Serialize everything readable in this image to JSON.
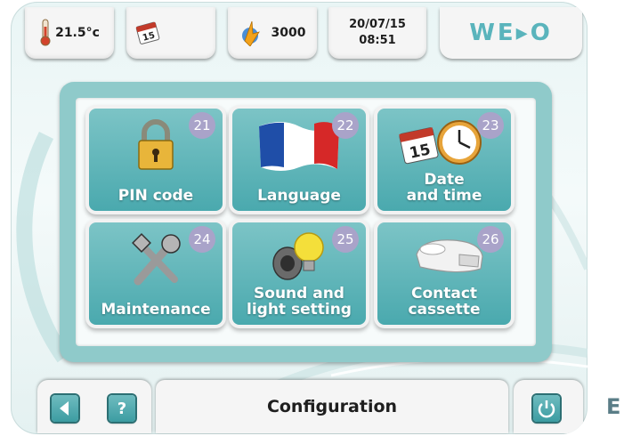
{
  "status_bar": {
    "temperature": "21.5°c",
    "counter": "3000",
    "date": "20/07/15",
    "time": "08:51",
    "logo": "WE▸O"
  },
  "tiles": [
    {
      "label": "PIN code",
      "number": "21",
      "icon": "padlock-icon"
    },
    {
      "label": "Language",
      "number": "22",
      "icon": "french-flag-icon"
    },
    {
      "label": "Date\nand time",
      "number": "23",
      "icon": "calendar-clock-icon"
    },
    {
      "label": "Maintenance",
      "number": "24",
      "icon": "tools-icon"
    },
    {
      "label": "Sound and\nlight setting",
      "number": "25",
      "icon": "speaker-bulb-icon"
    },
    {
      "label": "Contact\ncassette",
      "number": "26",
      "icon": "cassette-icon"
    }
  ],
  "footer": {
    "title": "Configuration",
    "back_icon": "back-arrow-icon",
    "help_label": "?",
    "power_icon": "power-icon"
  },
  "corner_letter": "E",
  "colors": {
    "tile_top": "#7cc4c6",
    "tile_bottom": "#4aa9ae",
    "frame": "#8fcaca",
    "badge": "#a9a3c9",
    "button": "#3c9ca2"
  }
}
